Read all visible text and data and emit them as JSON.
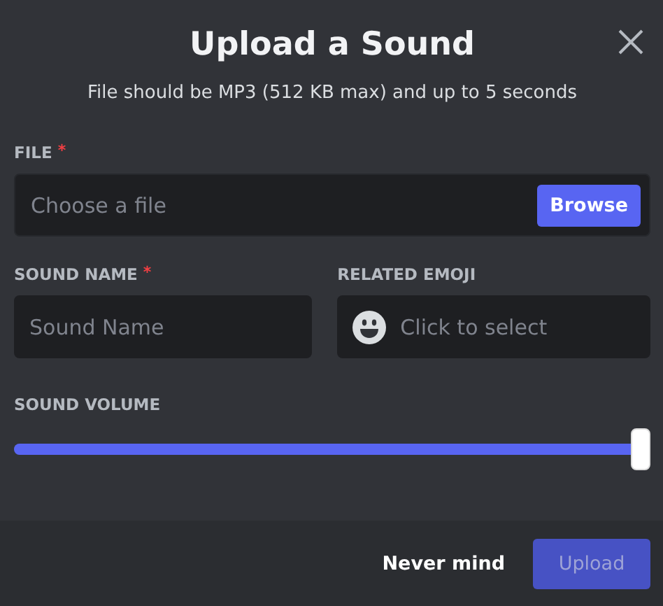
{
  "dialog": {
    "title": "Upload a Sound",
    "subtitle": "File should be MP3 (512 KB max) and up to 5 seconds"
  },
  "file": {
    "label": "FILE",
    "required_mark": "*",
    "placeholder": "Choose a file",
    "button": "Browse"
  },
  "sound_name": {
    "label": "SOUND NAME",
    "required_mark": "*",
    "placeholder": "Sound Name"
  },
  "related_emoji": {
    "label": "RELATED EMOJI",
    "placeholder": "Click to select"
  },
  "sound_volume": {
    "label": "SOUND VOLUME",
    "level": 1
  },
  "footer": {
    "cancel": "Never mind",
    "submit": "Upload",
    "submit_disabled": true
  }
}
